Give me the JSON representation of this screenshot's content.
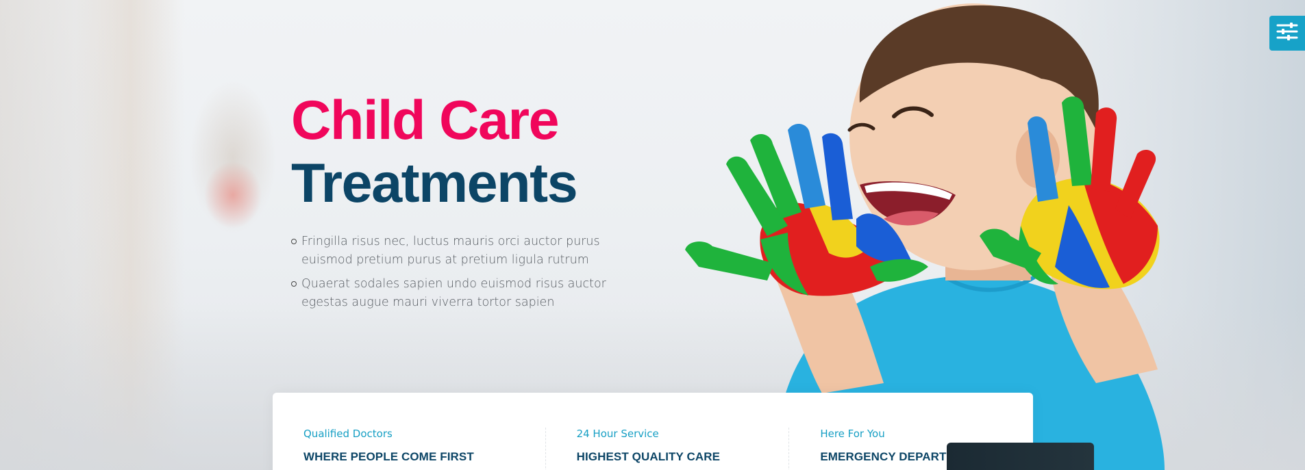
{
  "hero": {
    "title_line1": "Child Care",
    "title_line2": "Treatments",
    "bullets": [
      "Fringilla risus nec, luctus mauris orci auctor purus euismod pretium purus at pretium ligula rutrum",
      "Quaerat sodales sapien undo euismod risus auctor egestas augue mauri viverra tortor sapien"
    ]
  },
  "features": [
    {
      "subtitle": "Qualified Doctors",
      "heading": "WHERE PEOPLE COME FIRST"
    },
    {
      "subtitle": "24 Hour Service",
      "heading": "HIGHEST QUALITY CARE"
    },
    {
      "subtitle": "Here For You",
      "heading": "EMERGENCY DEPARTME"
    }
  ],
  "settings": {
    "icon": "sliders-icon"
  },
  "colors": {
    "accent_pink": "#f0065b",
    "dark_blue": "#0c4566",
    "teal": "#17a2c8"
  }
}
